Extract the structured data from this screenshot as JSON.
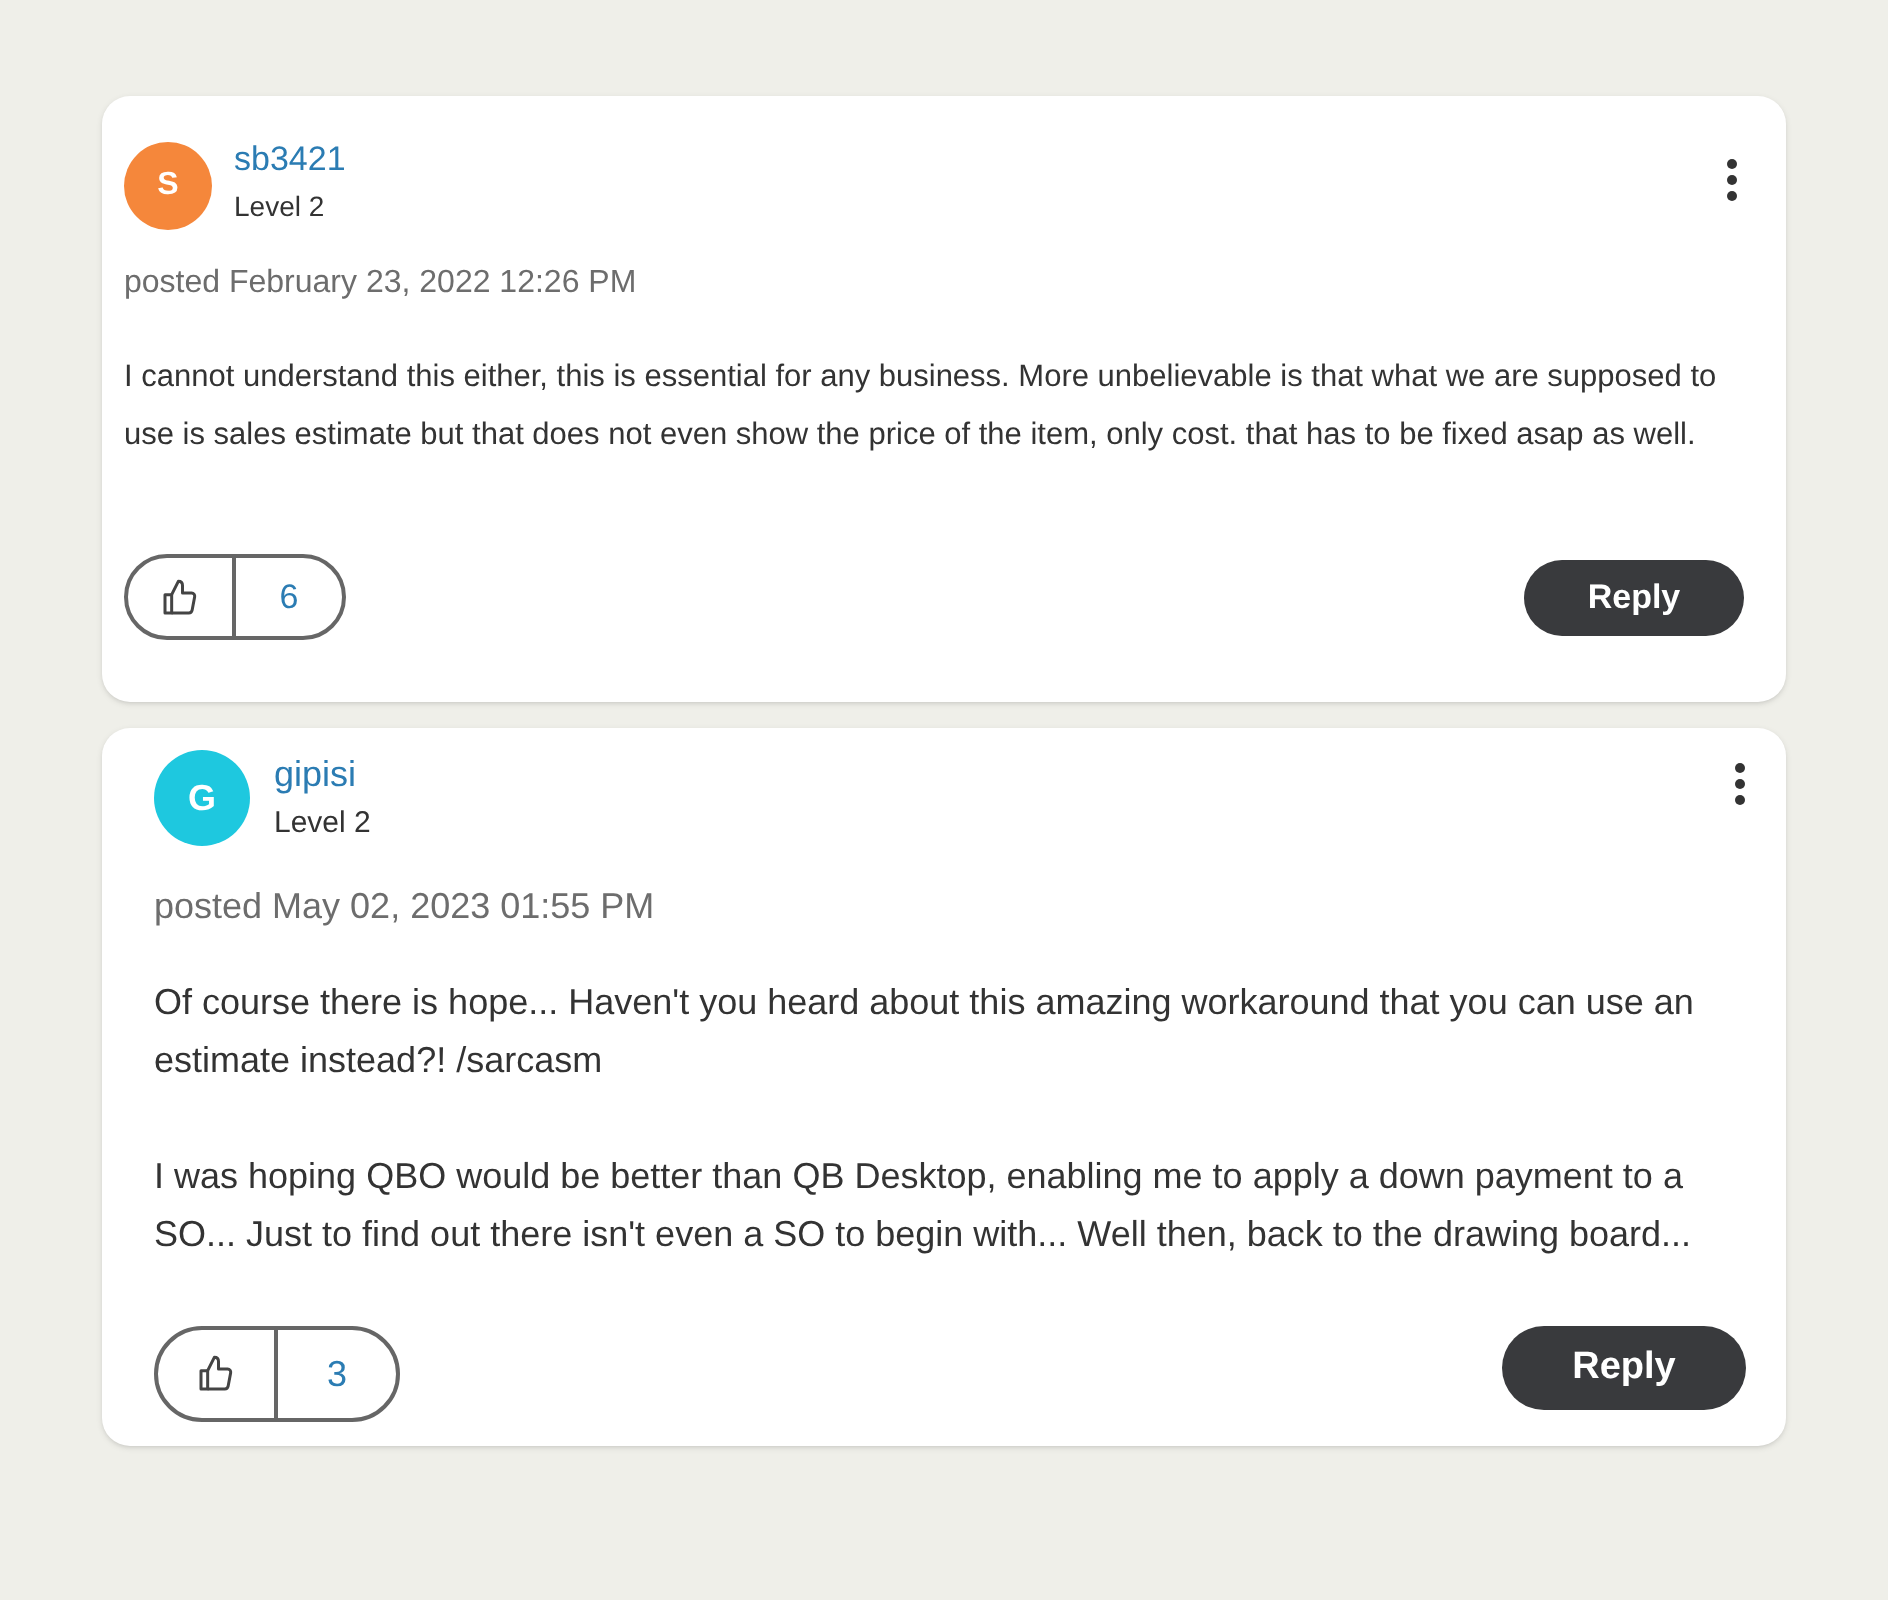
{
  "posts": [
    {
      "author": {
        "initial": "S",
        "name": "sb3421",
        "rank": "Level 2",
        "color": "#f5873b"
      },
      "posted": "posted February 23, 2022 12:26 PM",
      "body": [
        "I cannot understand this either, this is essential for any business. More unbelievable is that what we are supposed to use is sales estimate but that does not even show the price of the item, only cost. that has to be fixed asap as well."
      ],
      "likes": "6",
      "reply": "Reply"
    },
    {
      "author": {
        "initial": "G",
        "name": "gipisi",
        "rank": "Level 2",
        "color": "#1ec8df"
      },
      "posted": "posted May 02, 2023 01:55 PM",
      "body": [
        "Of course there is hope... Haven't you heard about this amazing workaround that you can use an estimate instead?! /sarcasm",
        "I was hoping QBO would be better than QB Desktop, enabling me to apply a down payment to a SO... Just to find out there isn't even a SO to begin with... Well then, back to the drawing board..."
      ],
      "likes": "3",
      "reply": "Reply"
    }
  ]
}
